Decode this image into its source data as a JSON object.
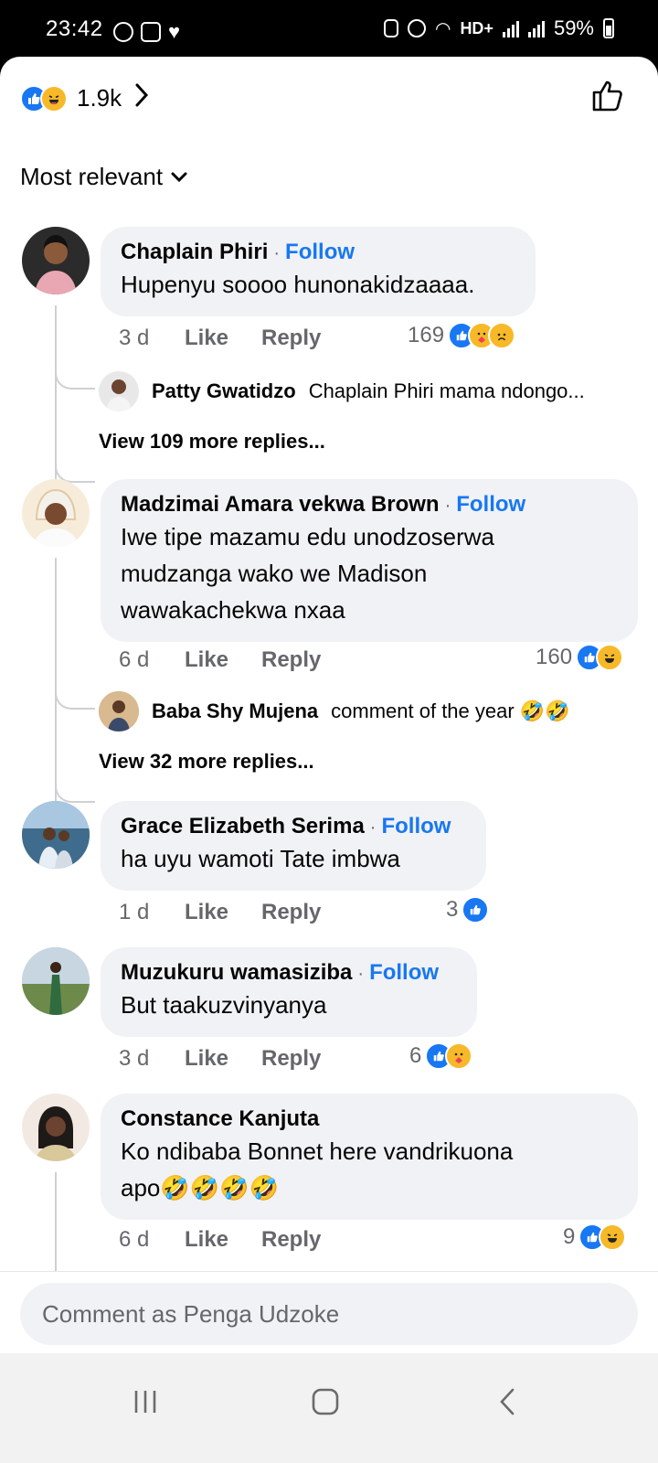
{
  "status_bar": {
    "time": "23:42",
    "network": "HD+",
    "battery": "59%"
  },
  "header": {
    "reaction_count": "1.9k",
    "sort_label": "Most relevant"
  },
  "comments": [
    {
      "name": "Chaplain Phiri",
      "follow": "Follow",
      "text_lines": [
        "Hupenyu soooo hunonakidzaaaa."
      ],
      "time": "3 d",
      "like": "Like",
      "reply": "Reply",
      "reaction_count": "169",
      "reactions": [
        "like",
        "care",
        "sad"
      ],
      "reply_preview": {
        "name": "Patty Gwatidzo",
        "text": "Chaplain Phiri mama ndongo..."
      },
      "view_more": "View 109 more replies..."
    },
    {
      "name": "Madzimai Amara vekwa Brown",
      "follow": "Follow",
      "text_lines": [
        "Iwe tipe mazamu edu unodzoserwa",
        "mudzanga wako we Madison",
        "wawakachekwa nxaa"
      ],
      "time": "6 d",
      "like": "Like",
      "reply": "Reply",
      "reaction_count": "160",
      "reactions": [
        "like",
        "haha"
      ],
      "reply_preview": {
        "name": "Baba Shy Mujena",
        "text": "comment  of the year 🤣🤣"
      },
      "view_more": "View 32 more replies..."
    },
    {
      "name": "Grace Elizabeth Serima",
      "follow": "Follow",
      "text_lines": [
        "ha uyu wamoti Tate imbwa"
      ],
      "time": "1 d",
      "like": "Like",
      "reply": "Reply",
      "reaction_count": "3",
      "reactions": [
        "like"
      ]
    },
    {
      "name": "Muzukuru wamasiziba",
      "follow": "Follow",
      "text_lines": [
        "But  taakuzvinyanya"
      ],
      "time": "3 d",
      "like": "Like",
      "reply": "Reply",
      "reaction_count": "6",
      "reactions": [
        "like",
        "care"
      ]
    },
    {
      "name": "Constance Kanjuta",
      "follow": "",
      "text_lines": [
        "Ko ndibaba Bonnet here vandrikuona",
        "apo🤣🤣🤣🤣"
      ],
      "time": "6 d",
      "like": "Like",
      "reply": "Reply",
      "reaction_count": "9",
      "reactions": [
        "like",
        "haha"
      ]
    }
  ],
  "composer": {
    "placeholder": "Comment as Penga Udzoke"
  },
  "colors": {
    "accent": "#1877f2",
    "bubble": "#f0f2f5",
    "muted": "#65676b"
  }
}
